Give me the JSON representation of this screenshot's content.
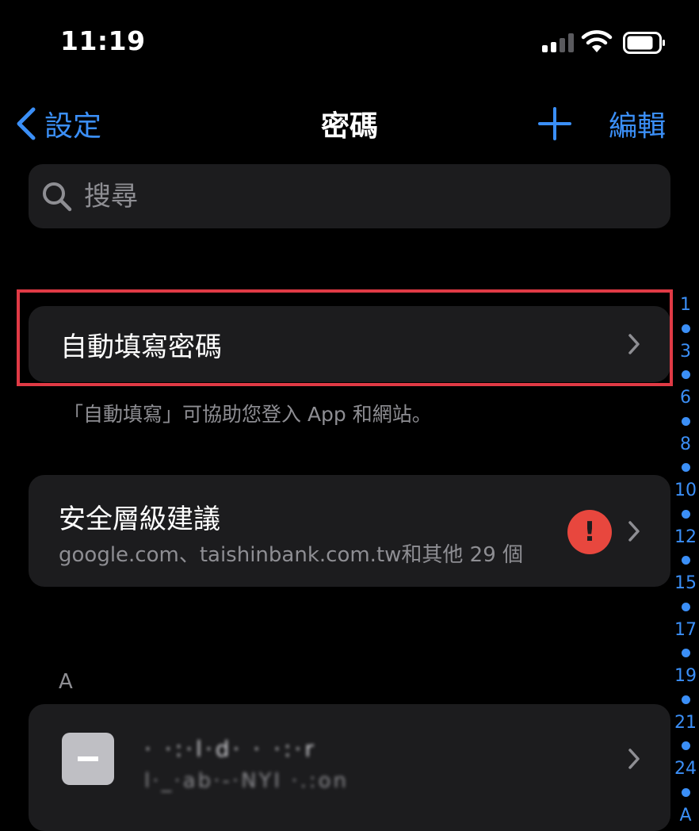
{
  "status_bar": {
    "time": "11:19"
  },
  "nav": {
    "back_label": "設定",
    "title": "密碼",
    "edit_label": "編輯"
  },
  "search": {
    "placeholder": "搜尋"
  },
  "autofill": {
    "label": "自動填寫密碼",
    "footnote": "「自動填寫」可協助您登入 App 和網站。"
  },
  "security": {
    "title": "安全層級建議",
    "subtitle": "google.com、taishinbank.com.tw和其他 29 個",
    "badge": "!"
  },
  "section_a": {
    "header": "A",
    "entries": [
      {
        "line1": "· ·:·l·d· · ·:·r",
        "line2": "l·_·ab·-·NYI ·.:on"
      }
    ]
  },
  "index": [
    "1",
    "3",
    "6",
    "8",
    "10",
    "12",
    "15",
    "17",
    "19",
    "21",
    "24",
    "A"
  ],
  "colors": {
    "accent": "#3b8ff7",
    "warning": "#e8473e",
    "highlight": "#e03a45",
    "cell": "#1c1c1e"
  }
}
